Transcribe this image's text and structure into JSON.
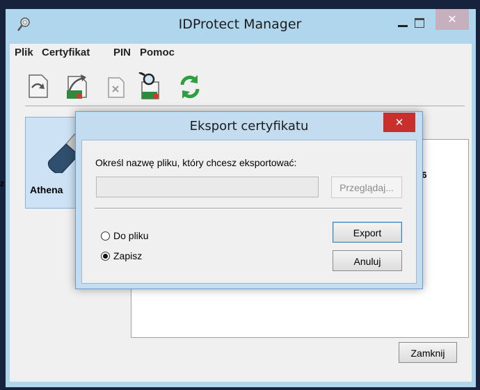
{
  "window": {
    "title": "IDProtect Manager",
    "close_glyph": "✕",
    "app_icon": "magnifier-key-icon"
  },
  "menu": [
    "Plik",
    "Certyfikat",
    "PIN",
    "Pomoc"
  ],
  "toolbar": {
    "buttons": [
      {
        "icon": "import-certificate-icon"
      },
      {
        "icon": "export-certificate-icon"
      },
      {
        "icon": "delete-certificate-icon"
      },
      {
        "icon": "view-certificate-icon"
      },
      {
        "icon": "refresh-icon"
      }
    ]
  },
  "device": {
    "label": "Athena",
    "icon": "usb-token-icon"
  },
  "left_edge_text": "z",
  "right_pane": {
    "partial_text": "c6"
  },
  "main_close_button": "Zamknij",
  "dialog": {
    "title": "Eksport certyfikatu",
    "close_glyph": "✕",
    "prompt": "Określ nazwę pliku, który chcesz eksportować:",
    "path_value": "",
    "browse_button": "Przeglądaj...",
    "options": [
      {
        "label": "Do pliku",
        "checked": false
      },
      {
        "label": "Zapisz",
        "checked": true
      }
    ],
    "export_button": "Export",
    "cancel_button": "Anuluj"
  },
  "colors": {
    "titlebar": "#b0d6ee",
    "dialog_close": "#c9302c",
    "selection": "#cde3f5",
    "refresh_green": "#2ea043"
  }
}
